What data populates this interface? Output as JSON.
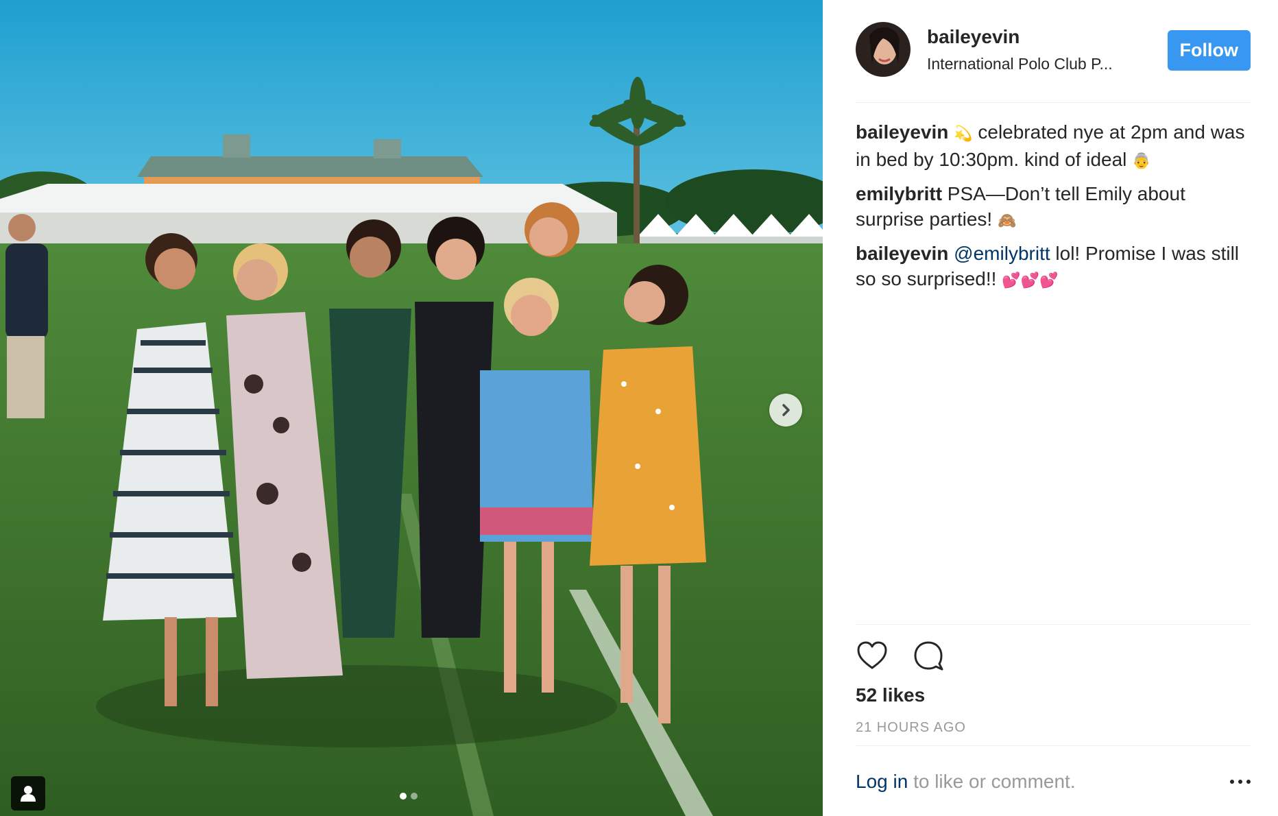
{
  "post": {
    "user": {
      "username": "baileyevin",
      "location": "International Polo Club P...",
      "follow_label": "Follow"
    },
    "comments": [
      {
        "username": "baileyevin",
        "segments": [
          {
            "type": "emoji",
            "text": "💫"
          },
          {
            "type": "text",
            "text": " celebrated nye at 2pm and was in bed by 10:30pm. kind of ideal "
          },
          {
            "type": "emoji",
            "text": "👵"
          }
        ]
      },
      {
        "username": "emilybritt",
        "segments": [
          {
            "type": "text",
            "text": " PSA—Don’t tell Emily about surprise parties! "
          },
          {
            "type": "emoji",
            "text": "🙈"
          }
        ]
      },
      {
        "username": "baileyevin",
        "segments": [
          {
            "type": "mention",
            "text": " @emilybritt"
          },
          {
            "type": "text",
            "text": " lol! Promise I was still so so surprised!! "
          },
          {
            "type": "emoji",
            "text": "💕💕💕"
          }
        ]
      }
    ],
    "likes_text": "52 likes",
    "timestamp": "21 HOURS AGO",
    "login_link": "Log in",
    "login_suffix": " to like or comment.",
    "carousel": {
      "current": 1,
      "total": 2
    },
    "icons": {
      "like": "heart-icon",
      "comment": "comment-bubble-icon",
      "next": "chevron-right-icon",
      "tag": "user-tag-icon",
      "more": "more-options-icon"
    },
    "colors": {
      "follow": "#3897f0",
      "link": "#003569",
      "muted": "#999999",
      "text": "#262626"
    }
  }
}
